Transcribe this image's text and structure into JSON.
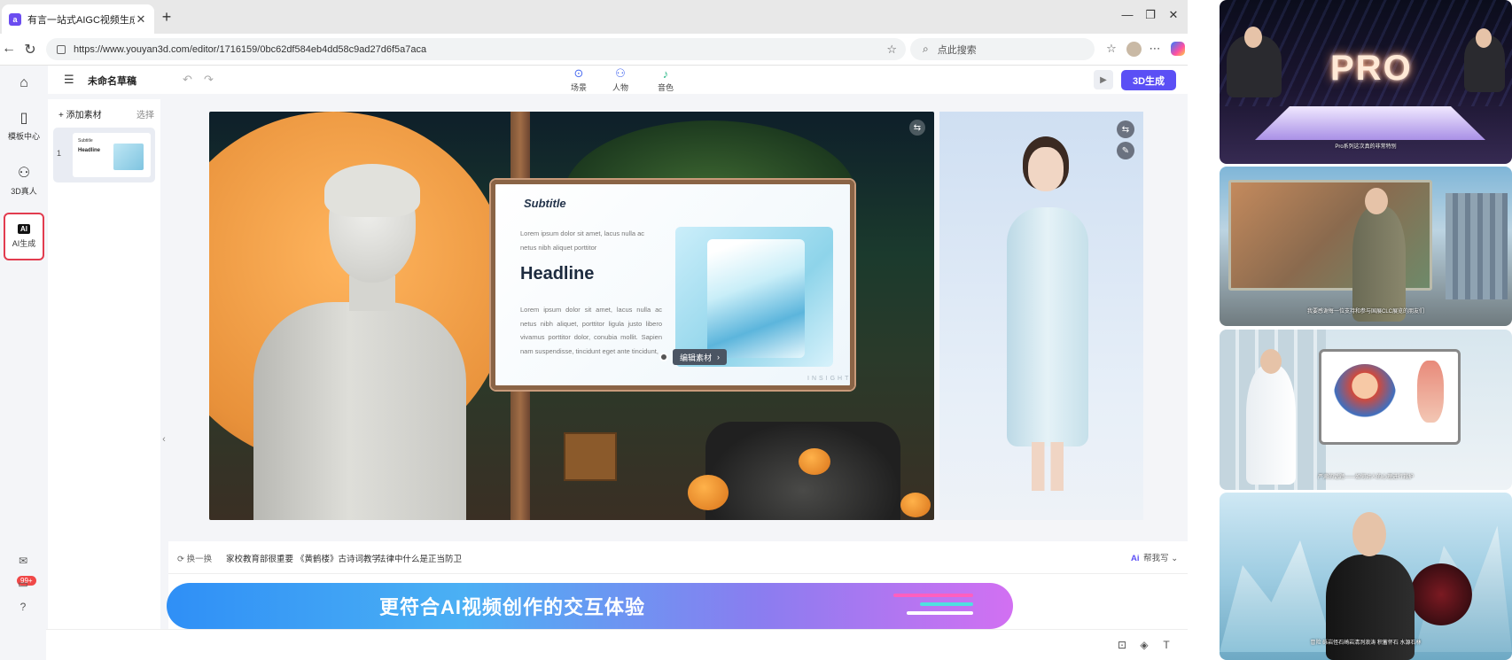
{
  "browser": {
    "tab_title": "有言一站式AIGC视频生成平台",
    "tab_favicon": "a",
    "url": "https://www.youyan3d.com/editor/1716159/0bc62df584eb4dd58c9ad27d6f5a7aca",
    "search_placeholder": "点此搜索"
  },
  "leftnav": {
    "items": [
      {
        "icon": "template-icon",
        "label": "模板中心"
      },
      {
        "icon": "person-icon",
        "label": "3D真人"
      },
      {
        "icon": "ai-icon",
        "label": "AI生成",
        "icon_text": "AI"
      }
    ],
    "badge": "99+"
  },
  "topbar": {
    "draft_title": "未命名草稿",
    "tools": [
      {
        "icon": "scene-icon",
        "label": "场景"
      },
      {
        "icon": "person-icon",
        "label": "人物"
      },
      {
        "icon": "microphone-icon",
        "label": "音色"
      }
    ],
    "generate_label": "3D生成"
  },
  "scenes": {
    "add_label": "+ 添加素材",
    "select_label": "选择",
    "items": [
      {
        "number": "1",
        "mini_title": "Subtitle",
        "mini_headline": "Headline"
      }
    ]
  },
  "stage": {
    "slide": {
      "subtitle": "Subtitle",
      "para1": "Lorem ipsum dolor sit amet, lacus nulla ac netus nibh aliquet porttitor",
      "headline": "Headline",
      "para2": "Lorem ipsum dolor sit amet, lacus nulla ac netus nibh aliquet, porttitor ligula justo libero vivamus porttitor dolor, conubia mollit. Sapien nam suspendisse, tincidunt eget ante tincidunt,",
      "insight": "INSIGHT"
    },
    "edit_chip": "编辑素材"
  },
  "script_bar": {
    "refresh_label": "换一换",
    "topics": [
      "家校教育部很重要",
      "《黄鹤楼》古诗词教学",
      "法律中什么是正当防卫"
    ],
    "ai_label": "帮我写",
    "ai_prefix": "Ai"
  },
  "banner": {
    "text": "更符合AI视频创作的交互体验"
  },
  "previews": [
    {
      "caption": "Pro系列这次真的非常特别",
      "text": "PRO"
    },
    {
      "caption": "我要感谢每一位支持和参与国展CLC展览的朋友们"
    },
    {
      "caption": "严肃的话题——如何对人的心理进行救护"
    },
    {
      "caption": "冒险 砾岩怪石崎岩清冽浪涛 积蓄怀石 水源石林"
    }
  ],
  "colors": {
    "accent": "#5b4ff5",
    "active_border": "#e23c4f",
    "banner_start": "#2f8ff6",
    "banner_end": "#d270f2"
  }
}
